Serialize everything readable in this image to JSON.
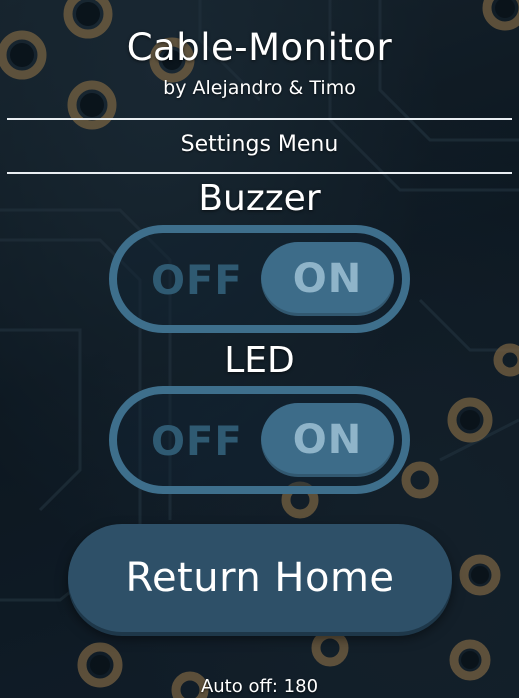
{
  "header": {
    "title": "Cable-Monitor",
    "subtitle": "by Alejandro & Timo"
  },
  "menu": {
    "section_title": "Settings Menu"
  },
  "settings": {
    "buzzer": {
      "label": "Buzzer",
      "off_label": "OFF",
      "on_label": "ON",
      "state": "on"
    },
    "led": {
      "label": "LED",
      "off_label": "OFF",
      "on_label": "ON",
      "state": "on"
    }
  },
  "actions": {
    "return_home_label": "Return Home"
  },
  "footer": {
    "auto_off_text": "Auto off: 180"
  },
  "colors": {
    "toggle_border": "#3e6f8c",
    "toggle_knob": "#3d6c89",
    "toggle_on_text": "#8fb4c9",
    "toggle_off_text": "#2f5a72",
    "button_bg": "#2e5068",
    "text": "#ffffff"
  }
}
